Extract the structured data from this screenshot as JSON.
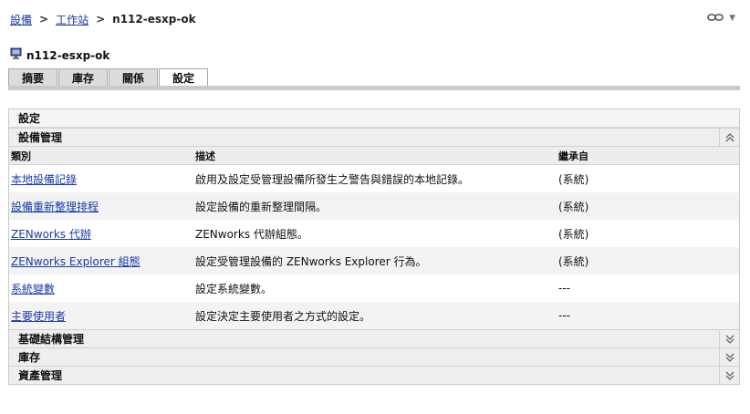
{
  "breadcrumb": {
    "items": [
      "設備",
      "工作站"
    ],
    "separator": ">",
    "current": "n112-esxp-ok"
  },
  "device": {
    "title": "n112-esxp-ok",
    "icon": "workstation-icon"
  },
  "tabs": [
    {
      "label": "摘要",
      "active": false
    },
    {
      "label": "庫存",
      "active": false
    },
    {
      "label": "關係",
      "active": false
    },
    {
      "label": "設定",
      "active": true
    }
  ],
  "settings": {
    "panel_title": "設定",
    "device_management": {
      "title": "設備管理",
      "columns": {
        "category": "類別",
        "description": "描述",
        "inherited_from": "繼承自"
      },
      "rows": [
        {
          "category": "本地設備記錄",
          "description": "啟用及設定受管理設備所發生之警告與錯誤的本地記錄。",
          "inherited_from": "(系統)"
        },
        {
          "category": "設備重新整理排程",
          "description": "設定設備的重新整理間隔。",
          "inherited_from": "(系統)"
        },
        {
          "category": "ZENworks 代辦",
          "description": "ZENworks 代辦組態。",
          "inherited_from": "(系統)"
        },
        {
          "category": "ZENworks Explorer 組態",
          "description": "設定受管理設備的 ZENworks Explorer 行為。",
          "inherited_from": "(系統)"
        },
        {
          "category": "系統變數",
          "description": "設定系統變數。",
          "inherited_from": "---"
        },
        {
          "category": "主要使用者",
          "description": "設定決定主要使用者之方式的設定。",
          "inherited_from": "---"
        }
      ]
    },
    "collapsed_sections": [
      {
        "title": "基礎結構管理"
      },
      {
        "title": "庫存"
      },
      {
        "title": "資產管理"
      }
    ]
  },
  "colors": {
    "link": "#1a3aa8",
    "tab_bg": "#dcdcdc",
    "header_bg": "#eeeeee"
  }
}
